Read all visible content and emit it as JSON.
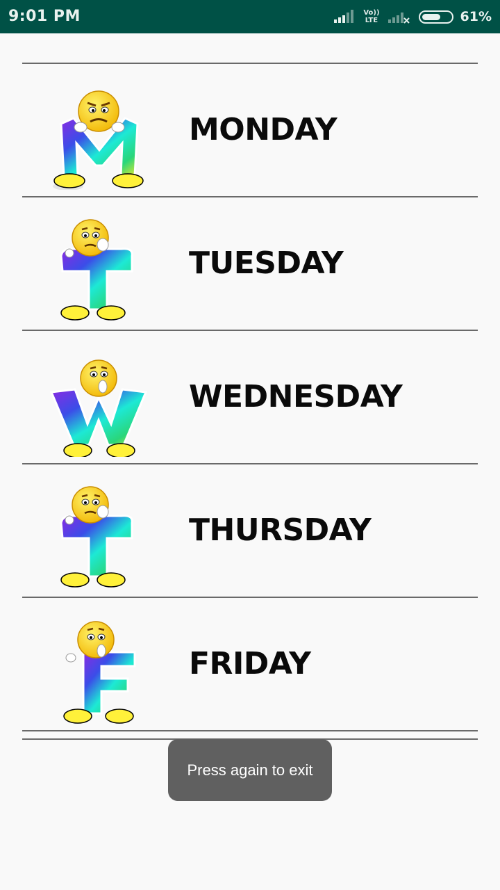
{
  "status_bar": {
    "time": "9:01 PM",
    "volte_line1": "Vo))",
    "volte_line2": "LTE",
    "battery": "61%",
    "battery_level": 0.61
  },
  "days": [
    {
      "label": "MONDAY",
      "letter": "M",
      "icon": "letter-m-emoji-icon"
    },
    {
      "label": "TUESDAY",
      "letter": "T",
      "icon": "letter-t-emoji-icon"
    },
    {
      "label": "WEDNESDAY",
      "letter": "W",
      "icon": "letter-w-emoji-icon"
    },
    {
      "label": "THURSDAY",
      "letter": "T",
      "icon": "letter-t-emoji-icon"
    },
    {
      "label": "FRIDAY",
      "letter": "F",
      "icon": "letter-f-emoji-icon"
    }
  ],
  "toast": {
    "text": "Press again to exit"
  },
  "colors": {
    "status_bar": "#005146",
    "background": "#f9f9f9",
    "toast_bg": "#606060",
    "text": "#0a0a0a"
  }
}
